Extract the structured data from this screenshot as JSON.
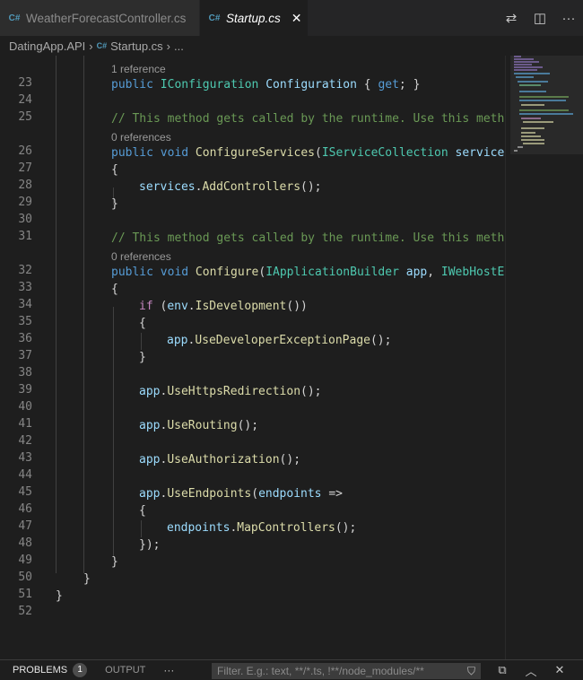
{
  "tabs": [
    {
      "label": "WeatherForecastController.cs",
      "icon": "csharp-file-icon",
      "active": false
    },
    {
      "label": "Startup.cs",
      "icon": "csharp-file-icon",
      "active": true
    }
  ],
  "tab_icon_glyph": "C#",
  "close_glyph": "✕",
  "tab_actions": [
    {
      "icon": "open-changes-icon",
      "glyph": "⇄"
    },
    {
      "icon": "split-editor-icon",
      "glyph": "◫"
    },
    {
      "icon": "more-actions-icon",
      "glyph": "···"
    }
  ],
  "breadcrumb": {
    "project": "DatingApp.API",
    "file": "Startup.cs",
    "more": "...",
    "separator": "›"
  },
  "codelens": {
    "ref_one": "1 reference",
    "ref_zero_a": "0 references",
    "ref_zero_b": "0 references"
  },
  "code": {
    "l23_kw": "public ",
    "l23_ty": "IConfiguration ",
    "l23_id": "Configuration",
    "l23_p1": " { ",
    "l23_kw2": "get",
    "l23_p2": "; }",
    "l25_cm": "// This method gets called by the runtime. Use this metho",
    "l26_kw": "public void ",
    "l26_fn": "ConfigureServices",
    "l26_p": "(",
    "l26_ty": "IServiceCollection ",
    "l26_id": "services",
    "brace_open": "{",
    "brace_close": "}",
    "l28_id": "services",
    "l28_dot": ".",
    "l28_fn": "AddControllers",
    "l28_end": "();",
    "l31_cm": "// This method gets called by the runtime. Use this metho",
    "l32_kw": "public void ",
    "l32_fn": "Configure",
    "l32_p": "(",
    "l32_ty": "IApplicationBuilder ",
    "l32_id": "app",
    "l32_c": ", ",
    "l32_ty2": "IWebHostEn",
    "l34_ctl": "if",
    "l34_p1": " (",
    "l34_id": "env",
    "l34_dot": ".",
    "l34_fn": "IsDevelopment",
    "l34_p2": "())",
    "app": "app",
    "dot": ".",
    "end": "();",
    "l36_fn": "UseDeveloperExceptionPage",
    "l39_fn": "UseHttpsRedirection",
    "l41_fn": "UseRouting",
    "l43_fn": "UseAuthorization",
    "l45_fn": "UseEndpoints",
    "l45_p": "(",
    "l45_id": "endpoints",
    "l45_arrow": " =>",
    "l47_id": "endpoints",
    "l47_fn": "MapControllers",
    "l48": "});"
  },
  "line_numbers": [
    "23",
    "24",
    "25",
    "26",
    "27",
    "28",
    "29",
    "30",
    "31",
    "32",
    "33",
    "34",
    "35",
    "36",
    "37",
    "38",
    "39",
    "40",
    "41",
    "42",
    "43",
    "44",
    "45",
    "46",
    "47",
    "48",
    "49",
    "50",
    "51",
    "52"
  ],
  "panel": {
    "problems_label": "PROBLEMS",
    "problems_count": "1",
    "output_label": "OUTPUT",
    "more": "···",
    "filter_placeholder": "Filter. E.g.: text, **/*.ts, !**/node_modules/**",
    "filter_icon": "filter-icon",
    "filter_glyph": "⛉",
    "icons": [
      {
        "icon": "collapse-all-icon",
        "glyph": "⧉"
      },
      {
        "icon": "maximize-panel-icon",
        "glyph": "︿"
      },
      {
        "icon": "close-panel-icon",
        "glyph": "✕"
      }
    ]
  },
  "colors": {
    "keyword": "#569cd6",
    "type": "#4ec9b0",
    "function": "#dcdcaa",
    "identifier": "#9cdcfe",
    "comment": "#6a9955",
    "control": "#c586c0",
    "editor_bg": "#1e1e1e"
  }
}
